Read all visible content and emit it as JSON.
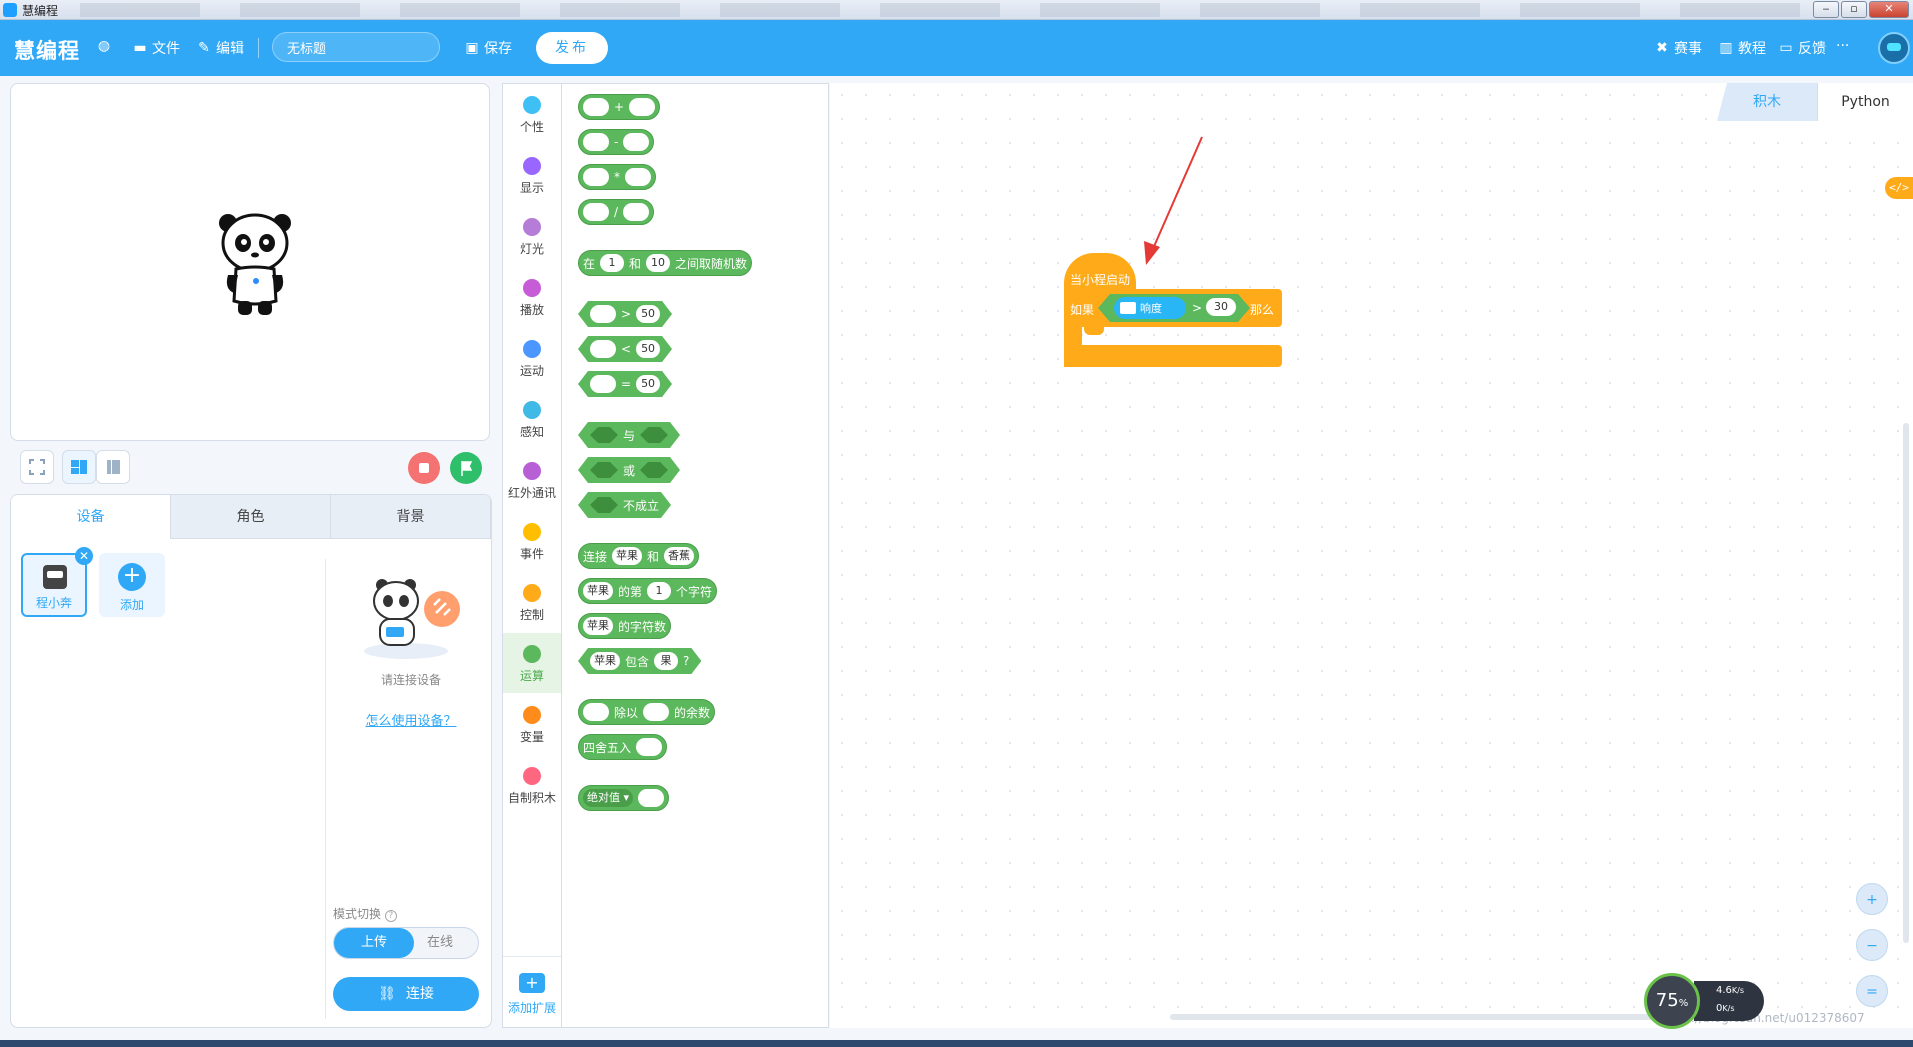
{
  "os": {
    "window_title": "慧编程",
    "ctrl_min": "‒",
    "ctrl_max": "▫",
    "ctrl_close": "✕"
  },
  "header": {
    "brand": "慧编程",
    "file_label": "文件",
    "edit_label": "编辑",
    "project_name": "无标题",
    "save_label": "保存",
    "publish_label": "发布",
    "contest_label": "赛事",
    "tutorial_label": "教程",
    "feedback_label": "反馈",
    "more_label": "···"
  },
  "device_panel": {
    "tabs": [
      "设备",
      "角色",
      "背景"
    ],
    "device_name": "程小奔",
    "add_label": "添加",
    "connect_prompt": "请连接设备",
    "help_link": "怎么使用设备？",
    "mode_label": "模式切换",
    "mode_upload": "上传",
    "mode_online": "在线",
    "connect_label": "连接"
  },
  "categories": [
    {
      "label": "个性",
      "color": "#3ec0f5"
    },
    {
      "label": "显示",
      "color": "#9966ff"
    },
    {
      "label": "灯光",
      "color": "#b57dd8"
    },
    {
      "label": "播放",
      "color": "#c65cd6"
    },
    {
      "label": "运动",
      "color": "#4c97ff"
    },
    {
      "label": "感知",
      "color": "#3fb9e5"
    },
    {
      "label": "红外通讯",
      "color": "#b85fd6"
    },
    {
      "label": "事件",
      "color": "#ffbf00"
    },
    {
      "label": "控制",
      "color": "#ffab19"
    },
    {
      "label": "运算",
      "color": "#5cb85c"
    },
    {
      "label": "变量",
      "color": "#ff8c1a"
    },
    {
      "label": "自制积木",
      "color": "#ff6680"
    }
  ],
  "add_extension_label": "添加扩展",
  "palette": {
    "plus": "+",
    "minus": "-",
    "times": "*",
    "divide": "/",
    "random_pre": "在",
    "random_from": "1",
    "random_and": "和",
    "random_to": "10",
    "random_post": "之间取随机数",
    "gt": ">",
    "lt": "<",
    "eq": "=",
    "num50": "50",
    "and": "与",
    "or": "或",
    "not": "不成立",
    "join": "连接",
    "apple": "苹果",
    "banana": "香蕉",
    "letter_of": "的第",
    "letter_idx": "1",
    "letter_unit": "个字符",
    "length": "的字符数",
    "contains": "包含",
    "fruit": "果",
    "question": "?",
    "mod_pre": "除以",
    "mod_post": "的余数",
    "round": "四舍五入",
    "abs": "绝对值 ▾"
  },
  "workspace": {
    "tab_blocks": "积木",
    "tab_python": "Python",
    "code_toggle": "</>",
    "hat_label": "当小程启动",
    "if_label": "如果",
    "sensor_label": "响度",
    "op_gt": ">",
    "value": "30",
    "then_label": "那么",
    "zoom_in": "+",
    "zoom_out": "−",
    "zoom_reset": "="
  },
  "net_widget": {
    "percent": "75",
    "percent_unit": "%",
    "up": "4.6",
    "up_unit": "K/s",
    "down": "0",
    "down_unit": "K/s"
  },
  "watermark": "https://blog.csdn.net/u012378607"
}
